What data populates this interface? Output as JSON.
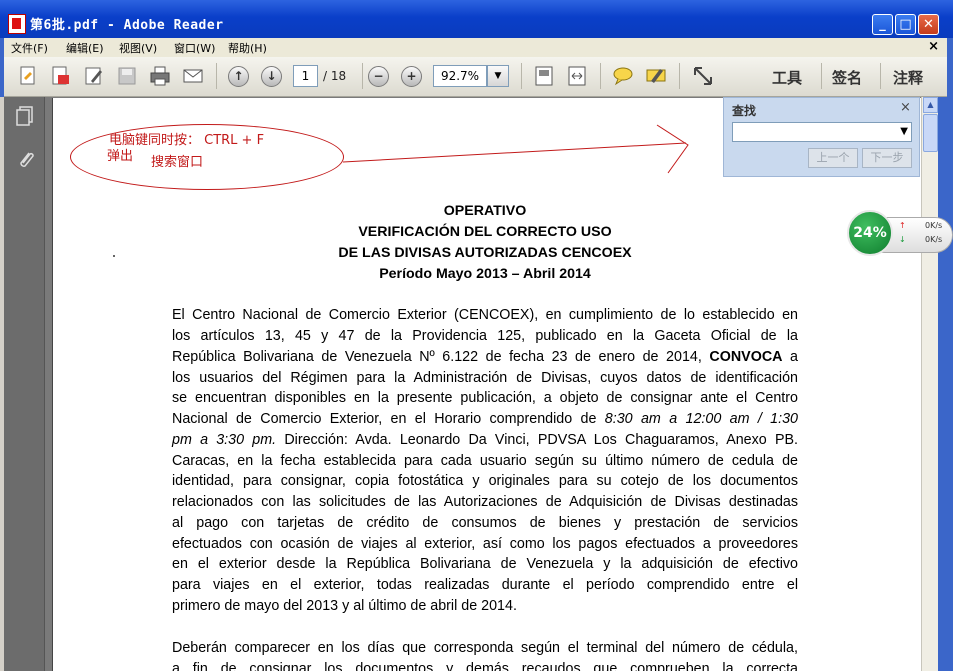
{
  "window": {
    "title": "第6批.pdf - Adobe Reader",
    "min": "_",
    "max": "□",
    "close": "✕"
  },
  "menu": {
    "items": [
      "文件(F)",
      "编辑(E)",
      "视图(V)",
      "窗口(W)",
      "帮助(H)"
    ],
    "close": "×"
  },
  "toolbar": {
    "icons": [
      "create-pdf-icon",
      "export-icon",
      "sign-icon",
      "save-icon",
      "print-icon",
      "email-icon"
    ],
    "page_current": "1",
    "page_total": "/ 18",
    "zoom": "92.7%",
    "zoom_arrow": "▼",
    "tools_label": "工具",
    "sign_label": "签名",
    "comment_label": "注释"
  },
  "find": {
    "title": "查找",
    "close": "×",
    "input_value": "",
    "prev_label": "上一个",
    "next_label": "下一步"
  },
  "speed_widget": {
    "percent": "24%",
    "up_rate": "0K/s",
    "down_rate": "0K/s",
    "up_arrow": "↑",
    "down_arrow": "↓"
  },
  "annotation": {
    "line1": "电脑键同时按： CTRL + F",
    "line2": "弹出",
    "line3": "搜索窗口"
  },
  "doc": {
    "heading": [
      "OPERATIVO",
      "VERIFICACIÓN DEL CORRECTO USO",
      "DE LAS DIVISAS AUTORIZADAS CENCOEX",
      "Período Mayo 2013 – Abril 2014"
    ],
    "para1": [
      "El Centro Nacional de Comercio Exterior (CENCOEX), en cumplimiento de lo establecido en",
      "los artículos 13, 45 y 47 de la Providencia 125, publicado en la Gaceta Oficial de la",
      "República Bolivariana de Venezuela Nº 6.122 de fecha 23 de enero de 2014,",
      "los usuarios del Régimen para la Administración de Divisas, cuyos datos de identificación",
      "se encuentran disponibles en la presente publicación, a objeto de consignar ante el Centro",
      "Nacional de Comercio Exterior, en el Horario comprendido de",
      "pm a 3:30 pm.",
      "Caracas, en la fecha establecida para cada usuario según su último número de cedula de",
      "identidad, para consignar, copia fotostática y originales para su cotejo de los documentos",
      "relacionados con las solicitudes de las Autorizaciones de Adquisición de Divisas destinadas",
      "al pago con tarjetas de crédito de consumos de bienes y prestación de servicios",
      "efectuados con ocasión de viajes al exterior, así como los pagos efectuados a proveedores",
      "en el exterior desde la República Bolivariana de Venezuela y la adquisición de efectivo",
      "para viajes en el exterior, todas realizadas durante el período comprendido entre el",
      "primero de mayo del 2013 y al último de  abril de 2014."
    ],
    "bold_convoca": "CONVOCA",
    "after_convoca": " a",
    "italic_time": "8:30 am a 12:00 am / 1:30",
    "after_pm": " Dirección: Avda. Leonardo Da Vinci, PDVSA Los Chaguaramos, Anexo PB.",
    "para2": [
      "Deberán comparecer en los días que corresponda según el terminal del número de cédula,",
      "a fin de consignar los documentos y demás recaudos que comprueben la correcta"
    ]
  },
  "sidenav": {
    "icons": [
      "pages-icon",
      "attachment-icon"
    ]
  }
}
